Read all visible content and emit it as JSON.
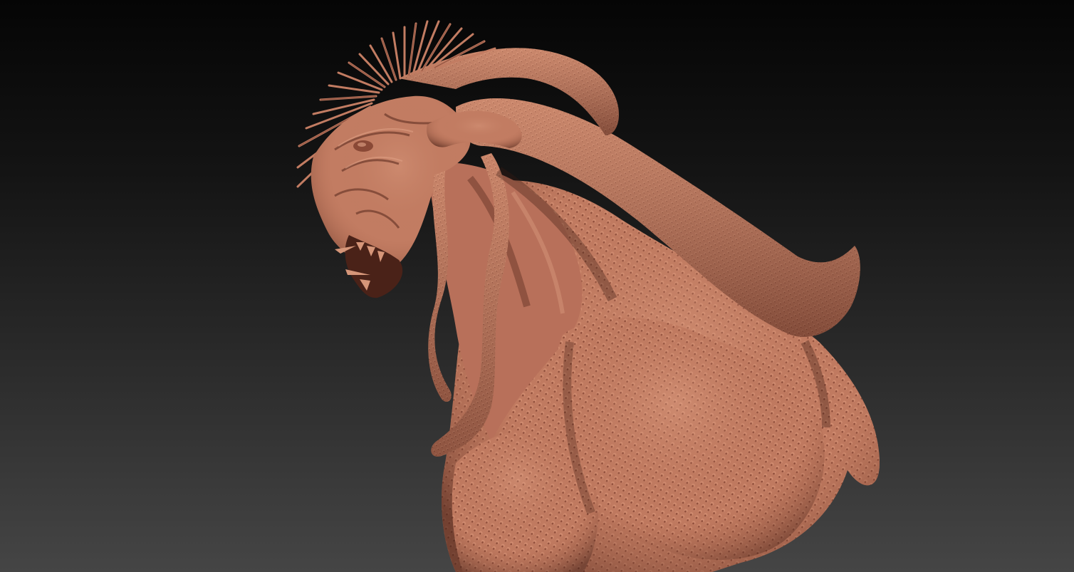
{
  "viewport": {
    "background_top": "#050505",
    "background_bottom": "#454545",
    "model_color": "#c27c62",
    "model_shadow": "#6e3a2b",
    "model_highlight": "#e3a589"
  }
}
